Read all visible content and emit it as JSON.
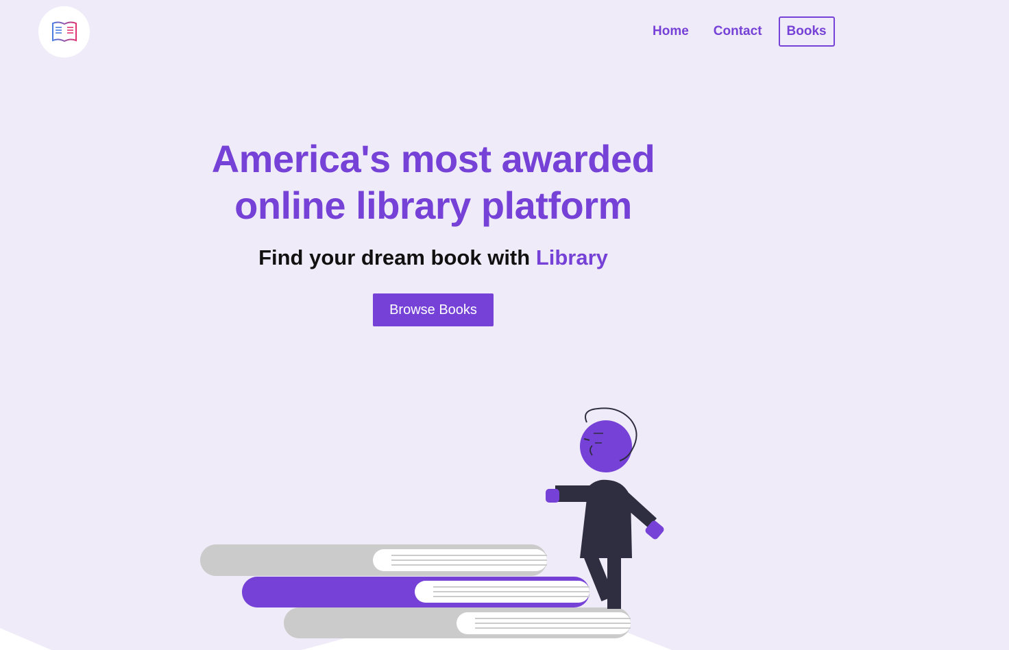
{
  "nav": {
    "items": [
      {
        "label": "Home",
        "active": false
      },
      {
        "label": "Contact",
        "active": false
      },
      {
        "label": "Books",
        "active": true
      }
    ]
  },
  "hero": {
    "headline_line1": "America's most awarded",
    "headline_line2": "online library platform",
    "tagline_prefix": "Find your dream book with ",
    "tagline_accent": "Library",
    "cta_label": "Browse Books"
  },
  "logo": {
    "icon": "open-book-icon"
  },
  "colors": {
    "background": "#f0ebf9",
    "accent": "#7541d6",
    "book_gray": "#cbcbcb",
    "figure_dark": "#2f2e41"
  }
}
